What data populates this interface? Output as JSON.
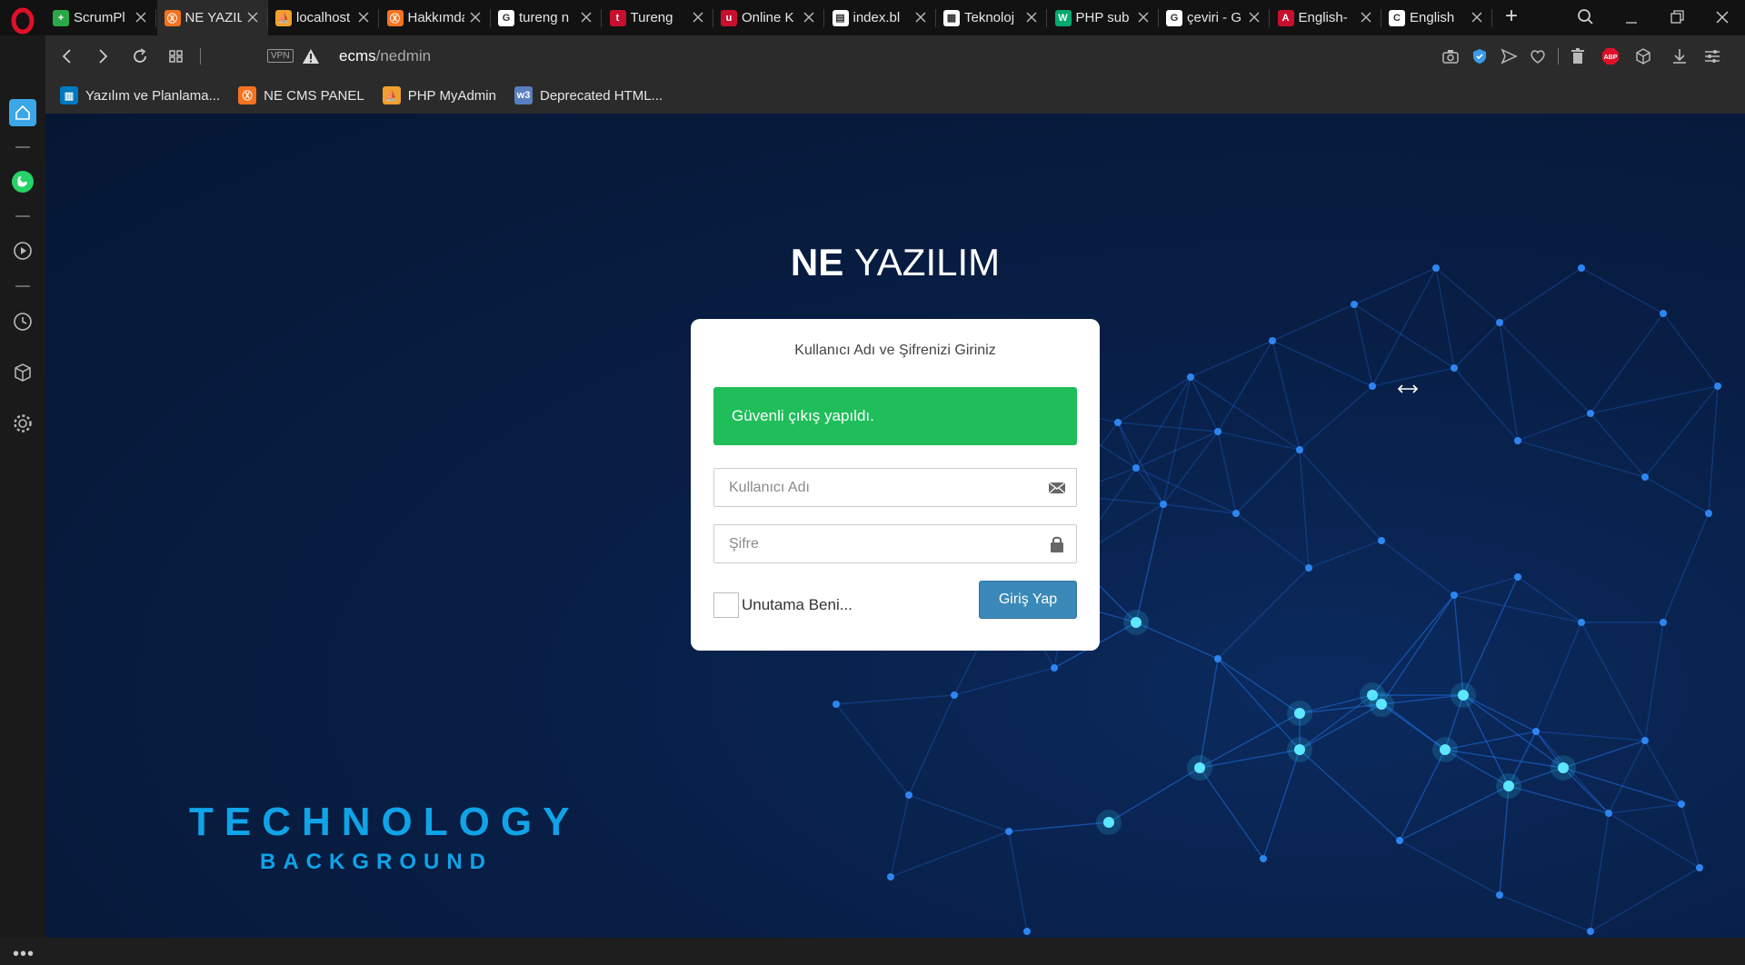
{
  "tabs": [
    {
      "label": "ScrumPl",
      "icon": "scrum-icon",
      "color": "#2aa84a",
      "glyph": "+",
      "active": false
    },
    {
      "label": "NE YAZIL",
      "icon": "xampp-icon",
      "color": "#f37321",
      "glyph": "Ⓧ",
      "active": true
    },
    {
      "label": "localhost",
      "icon": "phpmyadmin-icon",
      "color": "#f0a030",
      "glyph": "⛵",
      "active": false
    },
    {
      "label": "Hakkımda",
      "icon": "xampp-icon",
      "color": "#f37321",
      "glyph": "Ⓧ",
      "active": false
    },
    {
      "label": "tureng n",
      "icon": "google-icon",
      "color": "#ffffff",
      "glyph": "G",
      "active": false
    },
    {
      "label": "Tureng",
      "icon": "tureng-icon",
      "color": "#c8102e",
      "glyph": "t",
      "active": false
    },
    {
      "label": "Online K",
      "icon": "online-icon",
      "color": "#c8102e",
      "glyph": "u",
      "active": false
    },
    {
      "label": "index.bl",
      "icon": "file-icon",
      "color": "#ffffff",
      "glyph": "▤",
      "active": false
    },
    {
      "label": "Teknoloj",
      "icon": "page-icon",
      "color": "#ffffff",
      "glyph": "▦",
      "active": false
    },
    {
      "label": "PHP sub",
      "icon": "w3-icon",
      "color": "#04aa6d",
      "glyph": "W",
      "active": false
    },
    {
      "label": "çeviri - G",
      "icon": "google-icon",
      "color": "#ffffff",
      "glyph": "G",
      "active": false
    },
    {
      "label": "English-",
      "icon": "reverso-icon",
      "color": "#c8102e",
      "glyph": "A",
      "active": false
    },
    {
      "label": "English",
      "icon": "cambridge-icon",
      "color": "#ffffff",
      "glyph": "C",
      "active": false
    }
  ],
  "address": {
    "vpn": "VPN",
    "url_host": "ecms",
    "url_path": "/nedmin"
  },
  "bookmarks": [
    {
      "label": "Yazılım ve Planlama...",
      "icon": "trello-icon",
      "color": "#0079bf",
      "glyph": "▥"
    },
    {
      "label": "NE CMS PANEL",
      "icon": "xampp-icon",
      "color": "#f37321",
      "glyph": "Ⓧ"
    },
    {
      "label": "PHP MyAdmin",
      "icon": "phpmyadmin-icon",
      "color": "#f0a030",
      "glyph": "⛵"
    },
    {
      "label": "Deprecated HTML...",
      "icon": "w3schools-icon",
      "color": "#5a7fbf",
      "glyph": "w3"
    }
  ],
  "page": {
    "brand_bold": "NE",
    "brand_light": "YAZILIM",
    "bg_text_1": "TECHNOLOGY",
    "bg_text_2": "BACKGROUND"
  },
  "login": {
    "title": "Kullanıcı Adı ve Şifrenizi Giriniz",
    "alert": "Güvenli çıkış yapıldı.",
    "username_placeholder": "Kullanıcı Adı",
    "password_placeholder": "Şifre",
    "remember_label": "Unutama Beni...",
    "submit_label": "Giriş Yap"
  },
  "colors": {
    "alert_green": "#1fbe5a",
    "button_blue": "#3a89b8",
    "tech_text": "#10a3e8"
  }
}
